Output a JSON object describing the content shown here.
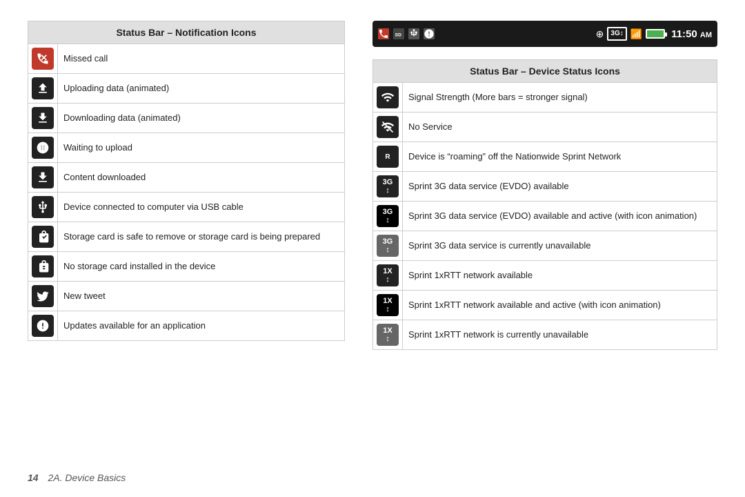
{
  "page": {
    "footer_number": "14",
    "footer_text": "2A. Device Basics"
  },
  "status_bar": {
    "time": "11:50",
    "am_pm": "AM"
  },
  "notification_table": {
    "header": "Status Bar – Notification Icons",
    "rows": [
      {
        "icon_type": "missed-call",
        "text": "Missed call"
      },
      {
        "icon_type": "upload-animated",
        "text": "Uploading data (animated)"
      },
      {
        "icon_type": "download-animated",
        "text": "Downloading data (animated)"
      },
      {
        "icon_type": "waiting-upload",
        "text": "Waiting to upload"
      },
      {
        "icon_type": "content-downloaded",
        "text": "Content downloaded"
      },
      {
        "icon_type": "usb",
        "text": "Device connected to computer via USB cable"
      },
      {
        "icon_type": "storage-safe",
        "text": "Storage card is safe to remove or storage card is being prepared"
      },
      {
        "icon_type": "no-storage",
        "text": "No storage card installed in the device"
      },
      {
        "icon_type": "tweet",
        "text": "New tweet"
      },
      {
        "icon_type": "update",
        "text": "Updates available for an application"
      }
    ]
  },
  "device_status_table": {
    "header": "Status Bar – Device Status Icons",
    "rows": [
      {
        "icon_type": "signal-strength",
        "text": "Signal Strength\n(More bars = stronger signal)"
      },
      {
        "icon_type": "no-service",
        "text": "No Service"
      },
      {
        "icon_type": "roaming",
        "text": "Device is “roaming” off the Nationwide Sprint Network"
      },
      {
        "icon_type": "3g-available",
        "text": "Sprint 3G data service (EVDO) available"
      },
      {
        "icon_type": "3g-active",
        "text": "Sprint 3G data service (EVDO) available and active (with icon animation)"
      },
      {
        "icon_type": "3g-unavailable",
        "text": "Sprint 3G data service is currently unavailable"
      },
      {
        "icon_type": "1x-available",
        "text": "Sprint 1xRTT network available"
      },
      {
        "icon_type": "1x-active",
        "text": "Sprint 1xRTT network available and active (with icon animation)"
      },
      {
        "icon_type": "1x-unavailable",
        "text": "Sprint 1xRTT network is currently unavailable"
      }
    ]
  }
}
